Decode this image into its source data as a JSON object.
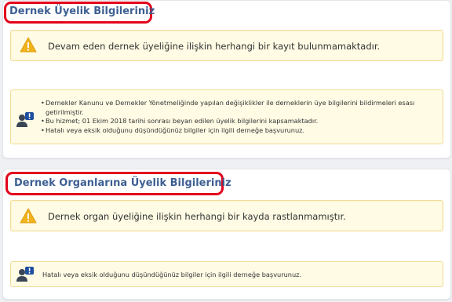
{
  "membership": {
    "title": "Dernek Üyelik Bilgileriniz",
    "warning": "Devam eden dernek üyeliğine ilişkin herhangi bir kayıt bulunmamaktadır.",
    "info_items": [
      "Dernekler Kanunu ve Dernekler Yönetmeliğinde yapılan değişiklikler ile derneklerin üye bilgilerini bildirmeleri esası getirilmiştir.",
      "Bu hizmet; 01 Ekim 2018 tarihi sonrası beyan edilen üyelik bilgilerini kapsamaktadır.",
      "Hatalı veya eksik olduğunu düşündüğünüz bilgiler için ilgili derneğe başvurunuz."
    ]
  },
  "organs": {
    "title": "Dernek Organlarına Üyelik Bilgileriniz",
    "warning": "Dernek organ üyeliğine ilişkin herhangi bir kayda rastlanmamıştır.",
    "info": "Hatalı veya eksik olduğunu düşündüğünüz bilgiler için ilgili derneğe başvurunuz."
  },
  "icons": {
    "warning": "warning-icon",
    "info": "user-info-icon",
    "highlight": "red-annotation-frame"
  },
  "colors": {
    "title": "#3d5f93",
    "highlight": "#e3001b",
    "warning_bg": "#fffbe4",
    "warning_border": "#f1dd9a",
    "warning_icon": "#f0b31c"
  }
}
